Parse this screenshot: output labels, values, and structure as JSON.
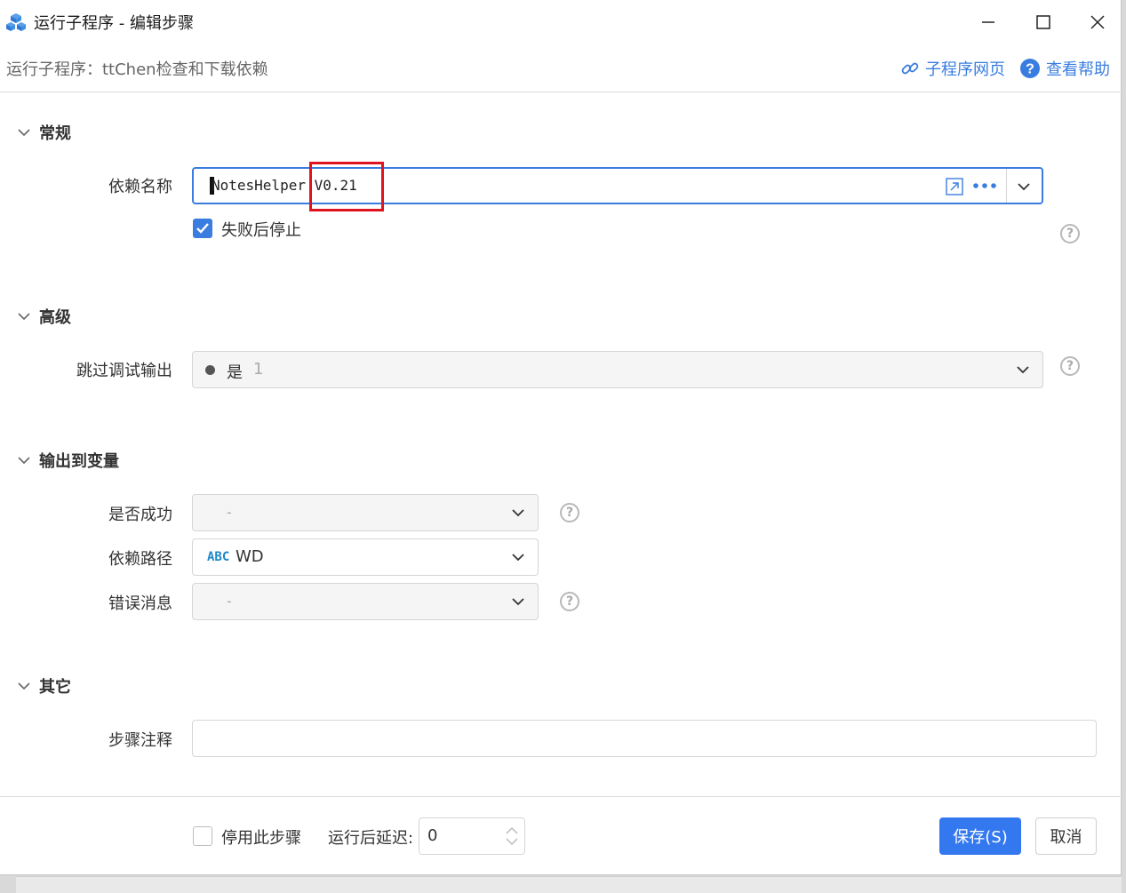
{
  "window": {
    "title": "运行子程序 - 编辑步骤",
    "subtitle": "运行子程序：ttChen检查和下载依赖",
    "link_subprogram": "子程序网页",
    "link_help": "查看帮助"
  },
  "sections": {
    "general": "常规",
    "advanced": "高级",
    "output": "输出到变量",
    "other": "其它"
  },
  "general": {
    "dep_label": "依赖名称",
    "dep_value": "NotesHelper V0.21",
    "stop_on_fail_label": "失败后停止",
    "stop_on_fail_checked": true
  },
  "advanced": {
    "skip_debug_label": "跳过调试输出",
    "skip_debug_value": "是",
    "skip_debug_number": "1"
  },
  "output": {
    "success_label": "是否成功",
    "success_value": "-",
    "path_label": "依赖路径",
    "path_type": "ABC",
    "path_value": "WD",
    "error_label": "错误消息",
    "error_value": "-"
  },
  "other": {
    "comment_label": "步骤注释",
    "comment_value": ""
  },
  "footer": {
    "disable_label": "停用此步骤",
    "disable_checked": false,
    "delay_label": "运行后延迟:",
    "delay_value": "0",
    "save_label": "保存(S)",
    "cancel_label": "取消"
  },
  "colors": {
    "accent": "#3478f0",
    "highlight": "#e0141e"
  }
}
